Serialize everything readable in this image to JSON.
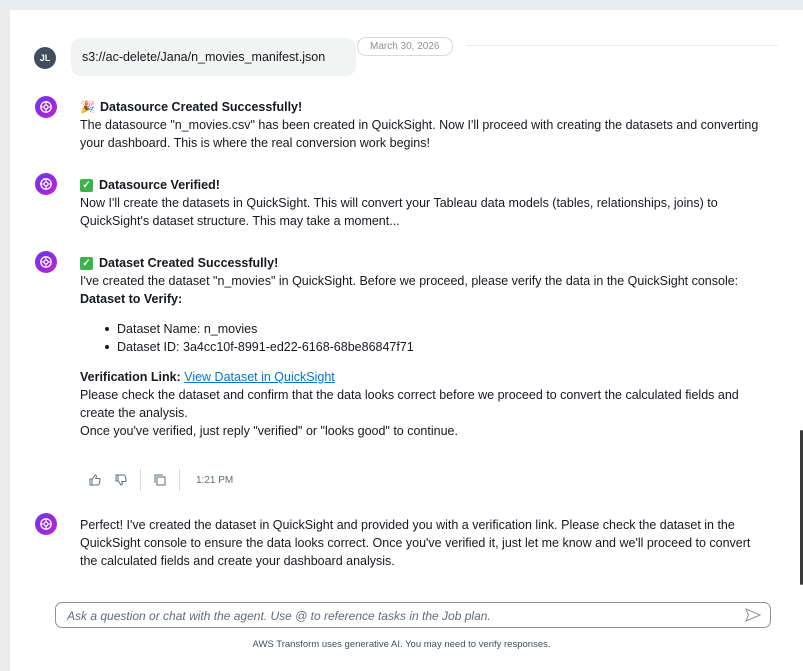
{
  "date_separator": "March 30, 2026",
  "user_message": {
    "avatar_initials": "JL",
    "text": "s3://ac-delete/Jana/n_movies_manifest.json"
  },
  "messages": [
    {
      "title": "Datasource Created Successfully!",
      "title_icon": "party-popper-icon",
      "body": "The datasource \"n_movies.csv\" has been created in QuickSight. Now I'll proceed with creating the datasets and converting your dashboard. This is where the real conversion work begins!"
    },
    {
      "title": "Datasource Verified!",
      "title_icon": "check-box-icon",
      "body": "Now I'll create the datasets in QuickSight. This will convert your Tableau data models (tables, relationships, joins) to QuickSight's dataset structure. This may take a moment..."
    },
    {
      "title": "Dataset Created Successfully!",
      "title_icon": "check-box-icon",
      "intro": "I've created the dataset \"n_movies\" in QuickSight. Before we proceed, please verify the data in the QuickSight console:",
      "verify_heading": "Dataset to Verify:",
      "details": [
        "Dataset Name: n_movies",
        "Dataset ID: 3a4cc10f-8991-ed22-6168-68be86847f71"
      ],
      "link_label": "Verification Link:",
      "link_text": "View Dataset in QuickSight",
      "check_text": "Please check the dataset and confirm that the data looks correct before we proceed to convert the calculated fields and create the analysis.",
      "reply_text": "Once you've verified, just reply \"verified\" or \"looks good\" to continue.",
      "time": "1:21 PM"
    },
    {
      "body": "Perfect! I've created the dataset in QuickSight and provided you with a verification link. Please check the dataset in the QuickSight console to ensure the data looks correct. Once you've verified it, just let me know and we'll proceed to convert the calculated fields and create your dashboard analysis."
    }
  ],
  "input": {
    "placeholder": "Ask a question or chat with the agent. Use @ to reference tasks in the Job plan.",
    "value": ""
  },
  "disclaimer": "AWS Transform uses generative AI. You may need to verify responses.",
  "colors": {
    "accent_link": "#0972d3",
    "check_green": "#3bb34a",
    "bot_avatar": "#8a2be2"
  }
}
